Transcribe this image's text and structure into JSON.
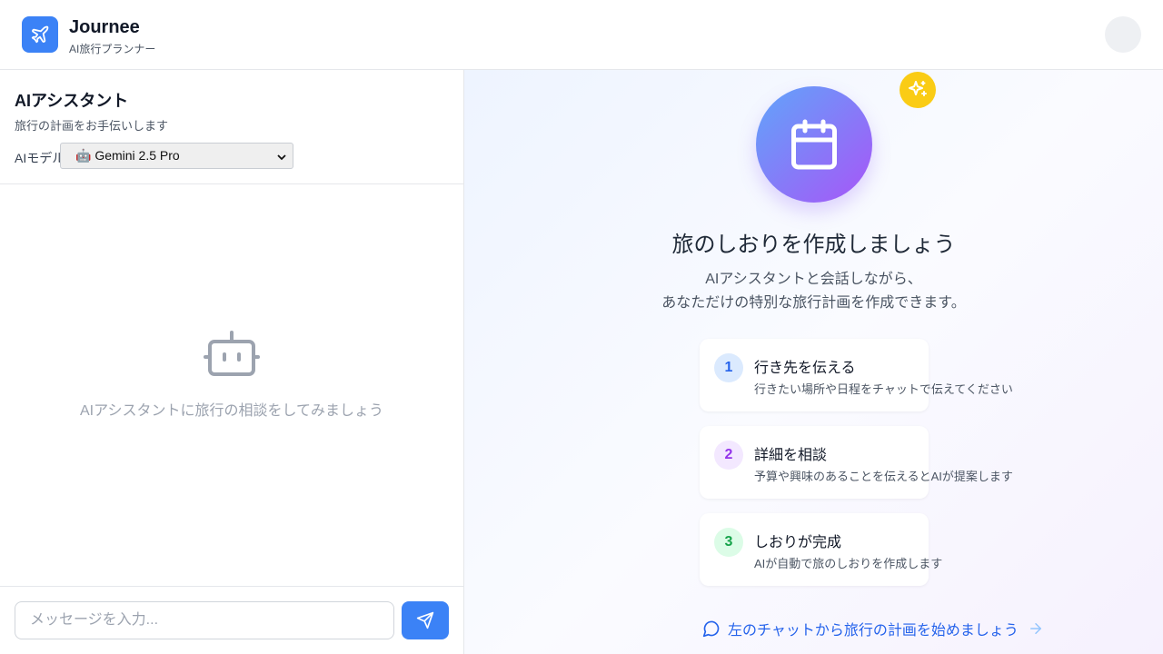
{
  "header": {
    "brand": "Journee",
    "subtitle": "AI旅行プランナー"
  },
  "chat": {
    "title": "AIアシスタント",
    "description": "旅行の計画をお手伝いします",
    "model_label": "AIモデル:",
    "model_selected": "🤖 Gemini 2.5 Pro",
    "empty_message": "AIアシスタントに旅行の相談をしてみましょう",
    "input_placeholder": "メッセージを入力..."
  },
  "welcome": {
    "title": "旅のしおりを作成しましょう",
    "desc_line1": "AIアシスタントと会話しながら、",
    "desc_line2": "あなただけの特別な旅行計画を作成できます。",
    "steps": [
      {
        "num": "1",
        "title": "行き先を伝える",
        "desc": "行きたい場所や日程をチャットで伝えてください",
        "color": "#2563eb",
        "bg": "#dbeafe"
      },
      {
        "num": "2",
        "title": "詳細を相談",
        "desc": "予算や興味のあることを伝えるとAIが提案します",
        "color": "#9333ea",
        "bg": "#f3e8ff"
      },
      {
        "num": "3",
        "title": "しおりが完成",
        "desc": "AIが自動で旅のしおりを作成します",
        "color": "#16a34a",
        "bg": "#dcfce7"
      }
    ],
    "cta": "左のチャットから旅行の計画を始めましょう"
  },
  "colors": {
    "accent": "#3b82f6",
    "badge": "#facc15"
  }
}
